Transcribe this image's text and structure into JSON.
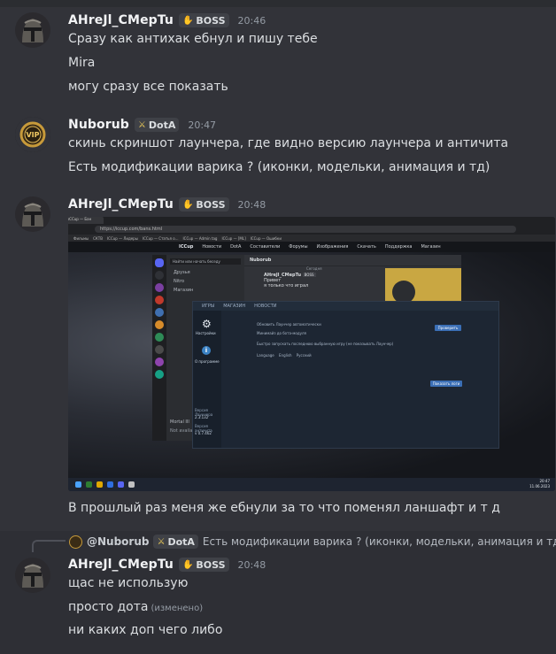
{
  "messages": [
    {
      "author": "AHreJl_CMepTu",
      "tag": "BOSS",
      "tag_icon": "hand-icon",
      "time": "20:46",
      "lines": [
        "Сразу как антихак ебнул и пишу тебе",
        "Mira",
        "могу сразу все показать"
      ]
    },
    {
      "author": "Nuborub",
      "tag": "DotA",
      "tag_icon": "sword-icon",
      "time": "20:47",
      "lines": [
        "скинь скриншот лаунчера, где видно версию лаунчера и античита",
        "Есть модификации варика ? (иконки, модельки, анимация и тд)"
      ]
    },
    {
      "author": "AHreJl_CMepTu",
      "tag": "BOSS",
      "tag_icon": "hand-icon",
      "time": "20:48",
      "attachment": {
        "browser_tab": "ICCup — Бан",
        "url": "https://iccup.com/bans.html",
        "bookmarks": [
          "Фильмы",
          "СКТВ",
          "ICCup — Лидеры",
          "ICCup — Статья о...",
          "ICCup — Admin tag",
          "ICCup — [ML]",
          "ICCup — Ошибки"
        ],
        "site_nav": [
          "Новости",
          "DotA",
          "Составители",
          "Форумы",
          "Изображения",
          "Скачать",
          "Поддержка",
          "Магазин"
        ],
        "site_logo": "ICCup",
        "discord": {
          "search": "Найти или начать беседу",
          "channels": [
            "Друзья",
            "Nitro",
            "Магазин"
          ],
          "chat_title": "Nuborub",
          "chat_author": "AHreJl_CMepTu",
          "chat_tag": "BOSS",
          "chat_lines": [
            "Привет",
            "я только что играл"
          ],
          "today": "Сегодня",
          "user_label": "Mortal III",
          "status": "Not available"
        },
        "launcher": {
          "tabs": [
            "ИГРЫ",
            "МАГАЗИН",
            "НОВОСТИ"
          ],
          "side_items": [
            "Настройки",
            "О программе"
          ],
          "options": [
            "Обновить Лаунчер автоматически",
            "Минимайз до бота-модуля",
            "Быстро запускать последнюю выбранную игру (не показывать Лаунчер)"
          ],
          "language_label": "Language",
          "languages": [
            "English",
            "Русский"
          ],
          "check_button": "Проверить",
          "logs_button": "Показать логи",
          "launcher_version_label": "Версия Лаунчера",
          "launcher_version": "2.3.132",
          "anticheat_version_label": "Версия античита",
          "anticheat_version": "v 0.7.462"
        },
        "clock_time": "20:47",
        "clock_date": "11.06.2023"
      },
      "lines": [
        "В прошлый раз меня же ебнули за то что поменял ланшафт и т д"
      ]
    },
    {
      "reply": {
        "author": "@Nuborub",
        "tag": "DotA",
        "tag_icon": "sword-icon",
        "text": "Есть модификации варика ? (иконки, модельки, анимация и тд)"
      },
      "author": "AHreJl_CMepTu",
      "tag": "BOSS",
      "tag_icon": "hand-icon",
      "time": "20:48",
      "lines": [
        "щас не использую",
        "просто дота",
        "ни каких доп чего либо"
      ],
      "edited_label": "(изменено)"
    }
  ],
  "colors": {
    "background": "#323339",
    "name": "#f2f3f5",
    "text": "#dbdee1",
    "muted": "#949ba4",
    "tag_bg": "#3f4147"
  }
}
